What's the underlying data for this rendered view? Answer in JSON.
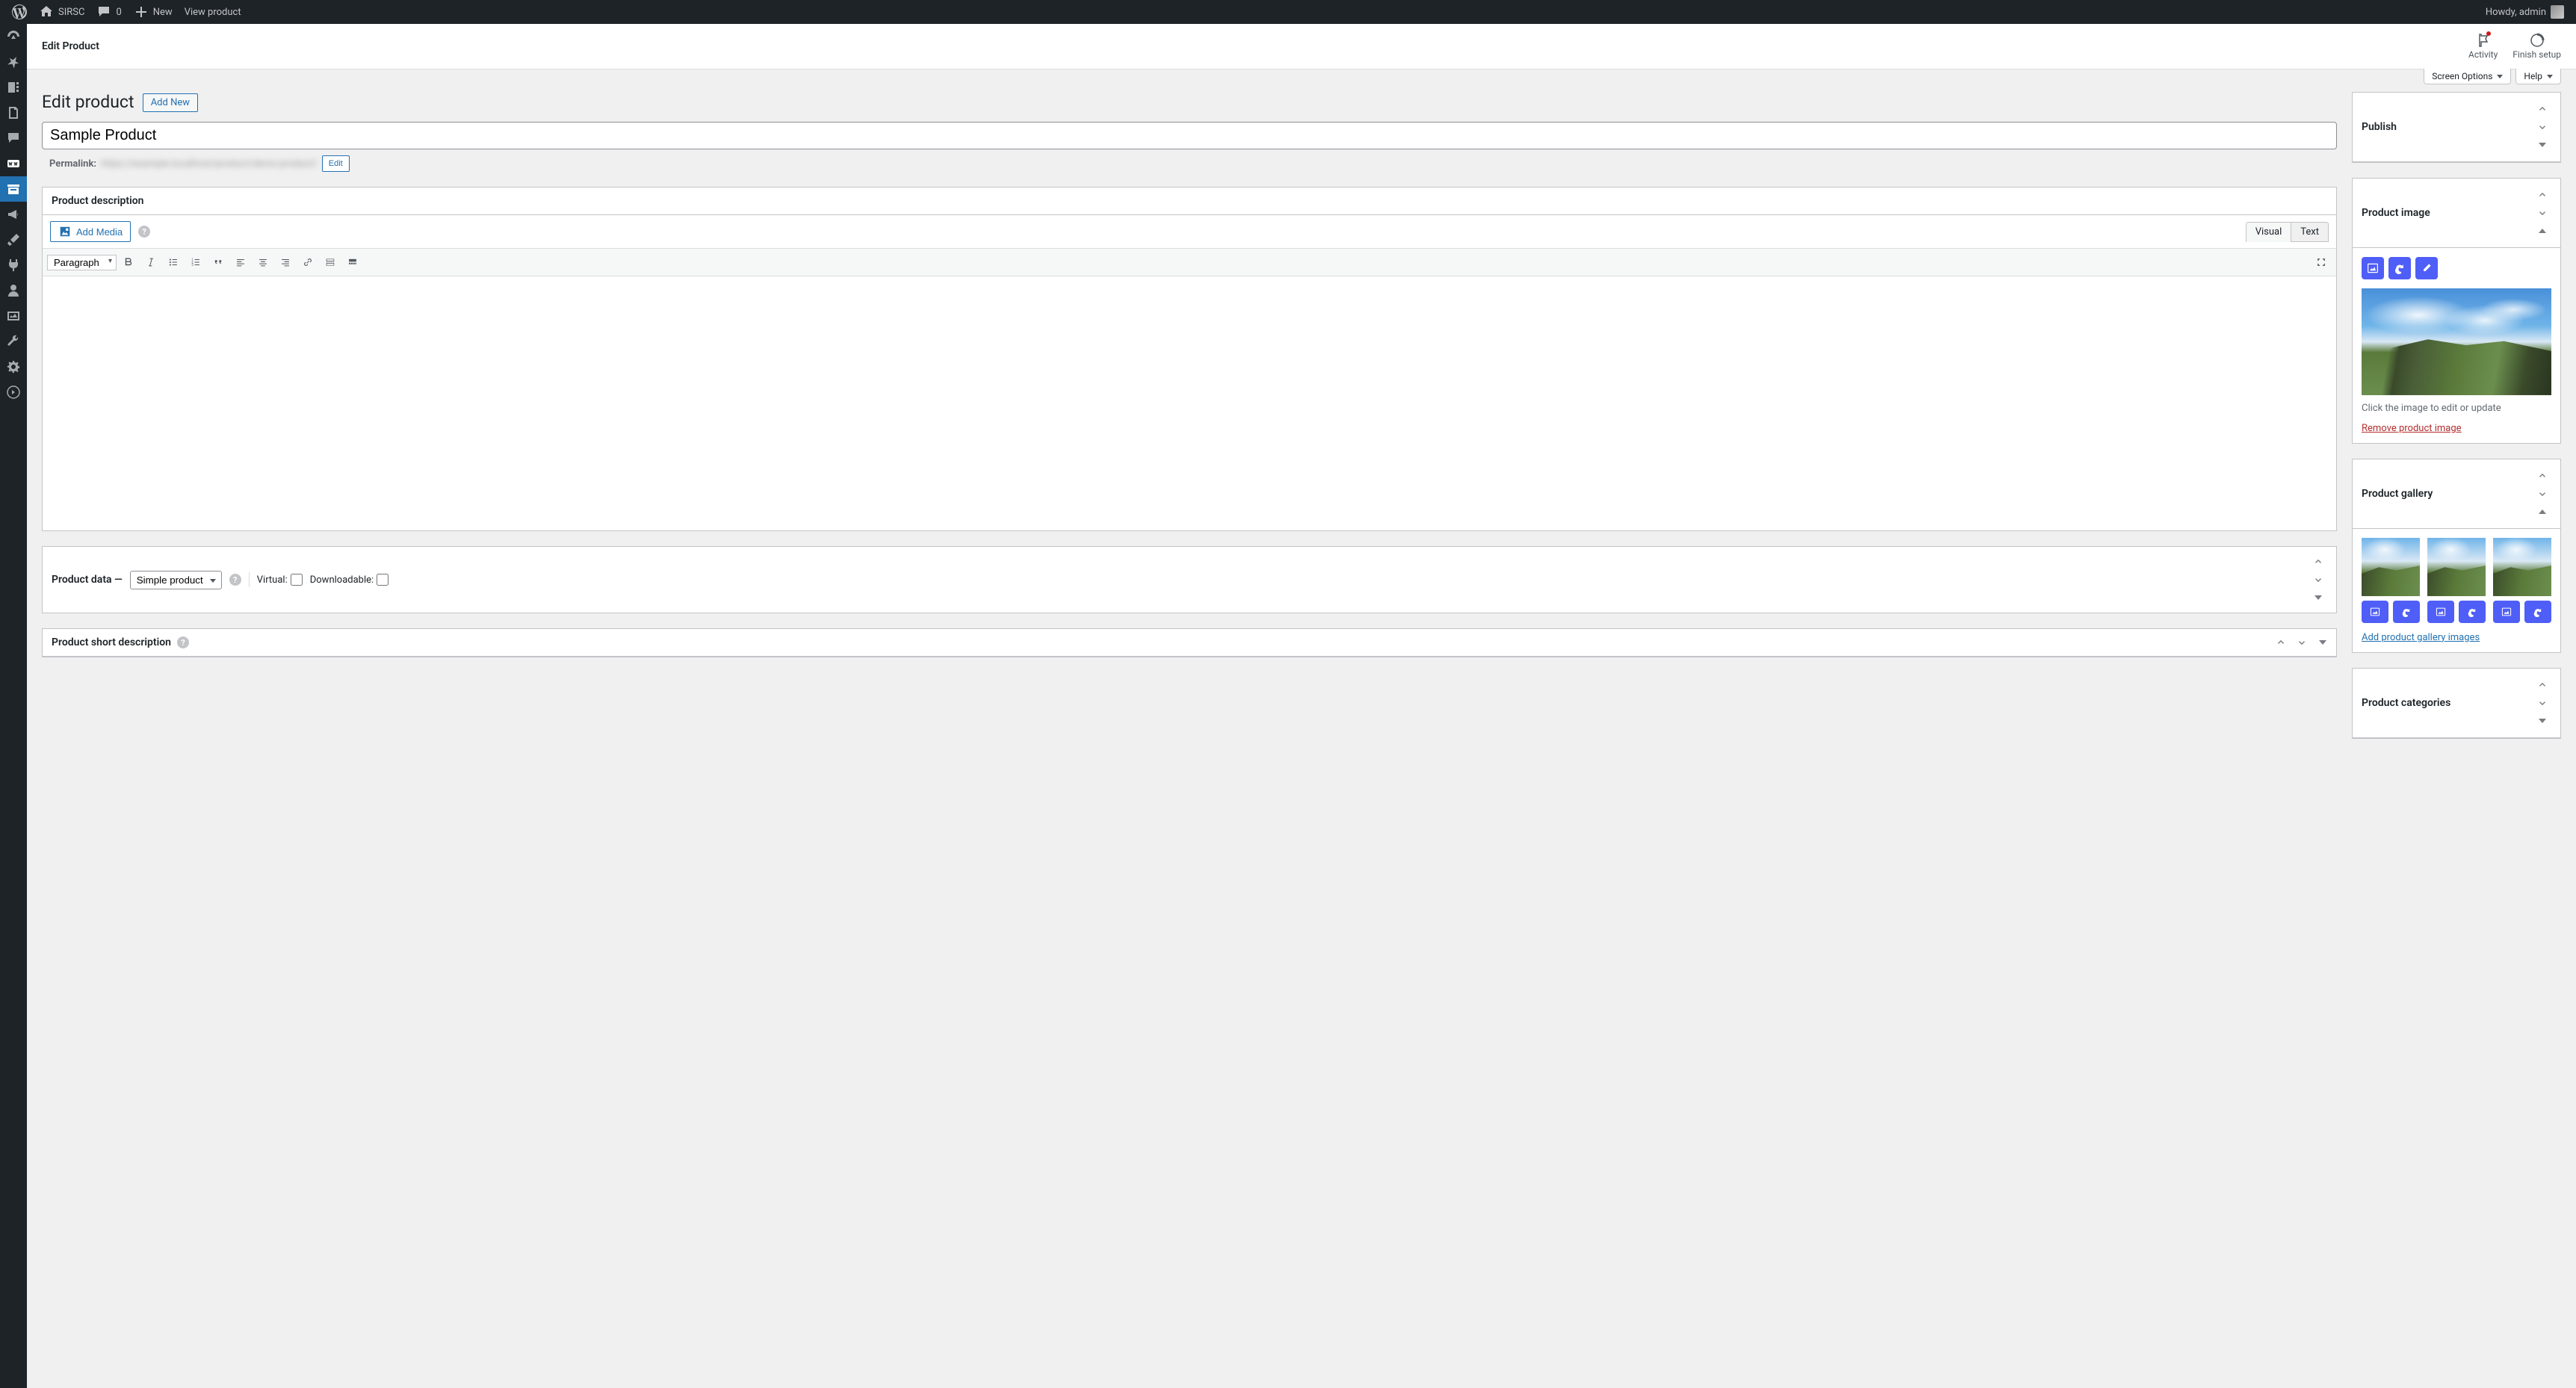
{
  "adminbar": {
    "site_name": "SIRSC",
    "comments_count": "0",
    "new_label": "New",
    "view_product": "View product",
    "howdy": "Howdy, admin"
  },
  "header": {
    "title": "Edit Product",
    "activity": "Activity",
    "finish_setup": "Finish setup"
  },
  "screen_meta": {
    "screen_options": "Screen Options",
    "help": "Help"
  },
  "page": {
    "heading": "Edit product",
    "add_new": "Add New",
    "product_title": "Sample Product",
    "permalink_label": "Permalink:",
    "permalink_edit": "Edit"
  },
  "editor": {
    "panel_title": "Product description",
    "add_media": "Add Media",
    "tab_visual": "Visual",
    "tab_text": "Text",
    "format_select": "Paragraph"
  },
  "product_data": {
    "title": "Product data —",
    "type": "Simple product",
    "virtual_label": "Virtual:",
    "downloadable_label": "Downloadable:"
  },
  "short_desc": {
    "title": "Product short description"
  },
  "sidebar": {
    "publish": {
      "title": "Publish"
    },
    "image": {
      "title": "Product image",
      "hint": "Click the image to edit or update",
      "remove": "Remove product image"
    },
    "gallery": {
      "title": "Product gallery",
      "add": "Add product gallery images"
    },
    "categories": {
      "title": "Product categories"
    }
  }
}
